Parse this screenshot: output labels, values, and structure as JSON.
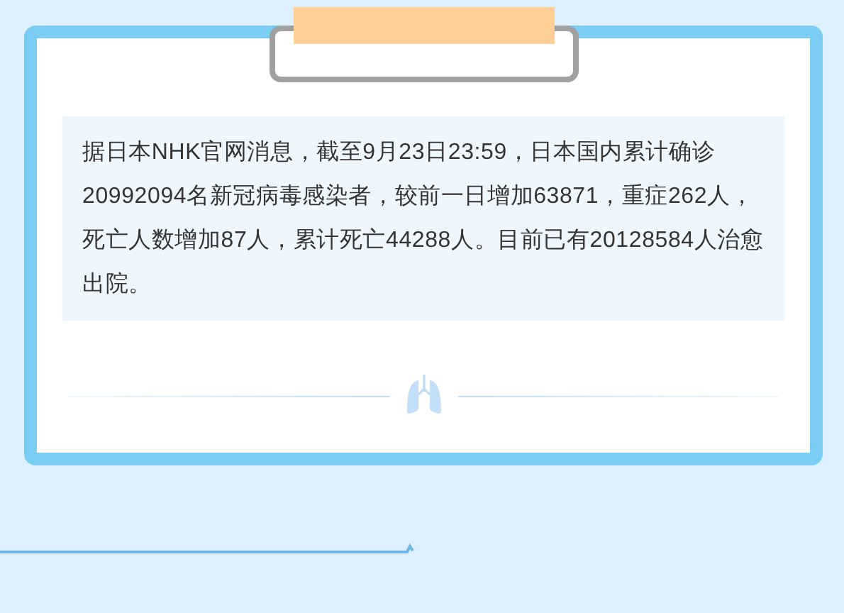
{
  "article": {
    "text": "据日本NHK官网消息，截至9月23日23:59，日本国内累计确诊20992094名新冠病毒感染者，较前一日增加63871，重症262人，死亡人数增加87人，累计死亡44288人。目前已有20128584人治愈出院。"
  }
}
